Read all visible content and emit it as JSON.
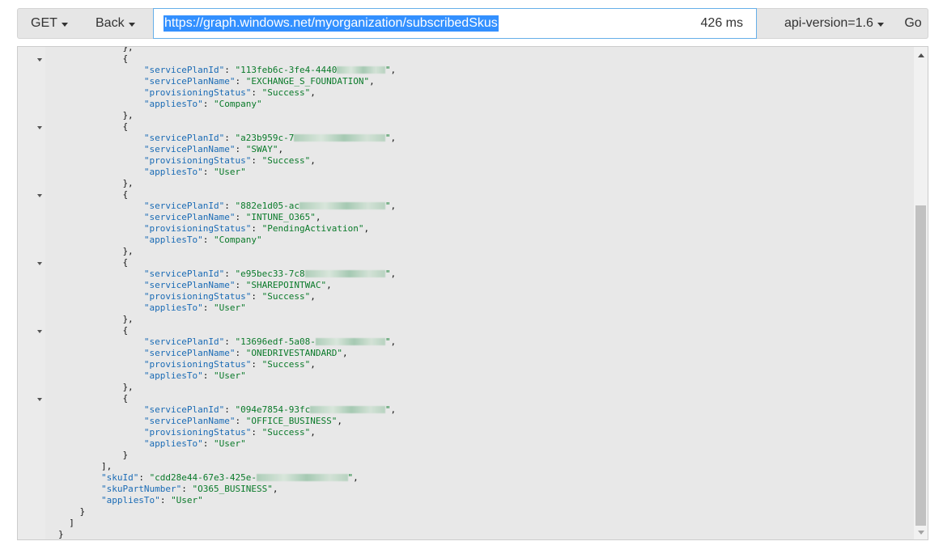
{
  "toolbar": {
    "method": "GET",
    "back": "Back",
    "url": "https://graph.windows.net/myorganization/subscribedSkus",
    "timing": "426 ms",
    "api_version": "api-version=1.6",
    "go": "Go"
  },
  "editor": {
    "lines": [
      {
        "indent": 12,
        "segs": [
          [
            "p",
            "},"
          ]
        ]
      },
      {
        "indent": 12,
        "fold": true,
        "segs": [
          [
            "p",
            "{"
          ]
        ]
      },
      {
        "indent": 16,
        "segs": [
          [
            "k",
            "\"servicePlanId\""
          ],
          [
            "p",
            ": "
          ],
          [
            "s",
            "\"113feb6c-3fe4-4440"
          ],
          [
            "blur",
            "9"
          ],
          [
            "s",
            "\""
          ],
          [
            "p",
            ","
          ]
        ]
      },
      {
        "indent": 16,
        "segs": [
          [
            "k",
            "\"servicePlanName\""
          ],
          [
            "p",
            ": "
          ],
          [
            "s",
            "\"EXCHANGE_S_FOUNDATION\""
          ],
          [
            "p",
            ","
          ]
        ]
      },
      {
        "indent": 16,
        "segs": [
          [
            "k",
            "\"provisioningStatus\""
          ],
          [
            "p",
            ": "
          ],
          [
            "s",
            "\"Success\""
          ],
          [
            "p",
            ","
          ]
        ]
      },
      {
        "indent": 16,
        "segs": [
          [
            "k",
            "\"appliesTo\""
          ],
          [
            "p",
            ": "
          ],
          [
            "s",
            "\"Company\""
          ]
        ]
      },
      {
        "indent": 12,
        "segs": [
          [
            "p",
            "},"
          ]
        ]
      },
      {
        "indent": 12,
        "fold": true,
        "segs": [
          [
            "p",
            "{"
          ]
        ]
      },
      {
        "indent": 16,
        "segs": [
          [
            "k",
            "\"servicePlanId\""
          ],
          [
            "p",
            ": "
          ],
          [
            "s",
            "\"a23b959c-7"
          ],
          [
            "blur",
            "17"
          ],
          [
            "s",
            "\""
          ],
          [
            "p",
            ","
          ]
        ]
      },
      {
        "indent": 16,
        "segs": [
          [
            "k",
            "\"servicePlanName\""
          ],
          [
            "p",
            ": "
          ],
          [
            "s",
            "\"SWAY\""
          ],
          [
            "p",
            ","
          ]
        ]
      },
      {
        "indent": 16,
        "segs": [
          [
            "k",
            "\"provisioningStatus\""
          ],
          [
            "p",
            ": "
          ],
          [
            "s",
            "\"Success\""
          ],
          [
            "p",
            ","
          ]
        ]
      },
      {
        "indent": 16,
        "segs": [
          [
            "k",
            "\"appliesTo\""
          ],
          [
            "p",
            ": "
          ],
          [
            "s",
            "\"User\""
          ]
        ]
      },
      {
        "indent": 12,
        "segs": [
          [
            "p",
            "},"
          ]
        ]
      },
      {
        "indent": 12,
        "fold": true,
        "segs": [
          [
            "p",
            "{"
          ]
        ]
      },
      {
        "indent": 16,
        "segs": [
          [
            "k",
            "\"servicePlanId\""
          ],
          [
            "p",
            ": "
          ],
          [
            "s",
            "\"882e1d05-ac"
          ],
          [
            "blur",
            "16"
          ],
          [
            "s",
            "\""
          ],
          [
            "p",
            ","
          ]
        ]
      },
      {
        "indent": 16,
        "segs": [
          [
            "k",
            "\"servicePlanName\""
          ],
          [
            "p",
            ": "
          ],
          [
            "s",
            "\"INTUNE_O365\""
          ],
          [
            "p",
            ","
          ]
        ]
      },
      {
        "indent": 16,
        "segs": [
          [
            "k",
            "\"provisioningStatus\""
          ],
          [
            "p",
            ": "
          ],
          [
            "s",
            "\"PendingActivation\""
          ],
          [
            "p",
            ","
          ]
        ]
      },
      {
        "indent": 16,
        "segs": [
          [
            "k",
            "\"appliesTo\""
          ],
          [
            "p",
            ": "
          ],
          [
            "s",
            "\"Company\""
          ]
        ]
      },
      {
        "indent": 12,
        "segs": [
          [
            "p",
            "},"
          ]
        ]
      },
      {
        "indent": 12,
        "fold": true,
        "segs": [
          [
            "p",
            "{"
          ]
        ]
      },
      {
        "indent": 16,
        "segs": [
          [
            "k",
            "\"servicePlanId\""
          ],
          [
            "p",
            ": "
          ],
          [
            "s",
            "\"e95bec33-7c8"
          ],
          [
            "blur",
            "15"
          ],
          [
            "s",
            "\""
          ],
          [
            "p",
            ","
          ]
        ]
      },
      {
        "indent": 16,
        "segs": [
          [
            "k",
            "\"servicePlanName\""
          ],
          [
            "p",
            ": "
          ],
          [
            "s",
            "\"SHAREPOINTWAC\""
          ],
          [
            "p",
            ","
          ]
        ]
      },
      {
        "indent": 16,
        "segs": [
          [
            "k",
            "\"provisioningStatus\""
          ],
          [
            "p",
            ": "
          ],
          [
            "s",
            "\"Success\""
          ],
          [
            "p",
            ","
          ]
        ]
      },
      {
        "indent": 16,
        "segs": [
          [
            "k",
            "\"appliesTo\""
          ],
          [
            "p",
            ": "
          ],
          [
            "s",
            "\"User\""
          ]
        ]
      },
      {
        "indent": 12,
        "segs": [
          [
            "p",
            "},"
          ]
        ]
      },
      {
        "indent": 12,
        "fold": true,
        "segs": [
          [
            "p",
            "{"
          ]
        ]
      },
      {
        "indent": 16,
        "segs": [
          [
            "k",
            "\"servicePlanId\""
          ],
          [
            "p",
            ": "
          ],
          [
            "s",
            "\"13696edf-5a08-"
          ],
          [
            "blur",
            "13"
          ],
          [
            "s",
            "\""
          ],
          [
            "p",
            ","
          ]
        ]
      },
      {
        "indent": 16,
        "segs": [
          [
            "k",
            "\"servicePlanName\""
          ],
          [
            "p",
            ": "
          ],
          [
            "s",
            "\"ONEDRIVESTANDARD\""
          ],
          [
            "p",
            ","
          ]
        ]
      },
      {
        "indent": 16,
        "segs": [
          [
            "k",
            "\"provisioningStatus\""
          ],
          [
            "p",
            ": "
          ],
          [
            "s",
            "\"Success\""
          ],
          [
            "p",
            ","
          ]
        ]
      },
      {
        "indent": 16,
        "segs": [
          [
            "k",
            "\"appliesTo\""
          ],
          [
            "p",
            ": "
          ],
          [
            "s",
            "\"User\""
          ]
        ]
      },
      {
        "indent": 12,
        "segs": [
          [
            "p",
            "},"
          ]
        ]
      },
      {
        "indent": 12,
        "fold": true,
        "segs": [
          [
            "p",
            "{"
          ]
        ]
      },
      {
        "indent": 16,
        "segs": [
          [
            "k",
            "\"servicePlanId\""
          ],
          [
            "p",
            ": "
          ],
          [
            "s",
            "\"094e7854-93fc"
          ],
          [
            "blur",
            "14"
          ],
          [
            "s",
            "\""
          ],
          [
            "p",
            ","
          ]
        ]
      },
      {
        "indent": 16,
        "segs": [
          [
            "k",
            "\"servicePlanName\""
          ],
          [
            "p",
            ": "
          ],
          [
            "s",
            "\"OFFICE_BUSINESS\""
          ],
          [
            "p",
            ","
          ]
        ]
      },
      {
        "indent": 16,
        "segs": [
          [
            "k",
            "\"provisioningStatus\""
          ],
          [
            "p",
            ": "
          ],
          [
            "s",
            "\"Success\""
          ],
          [
            "p",
            ","
          ]
        ]
      },
      {
        "indent": 16,
        "segs": [
          [
            "k",
            "\"appliesTo\""
          ],
          [
            "p",
            ": "
          ],
          [
            "s",
            "\"User\""
          ]
        ]
      },
      {
        "indent": 12,
        "segs": [
          [
            "p",
            "}"
          ]
        ]
      },
      {
        "indent": 8,
        "segs": [
          [
            "p",
            "],"
          ]
        ]
      },
      {
        "indent": 8,
        "segs": [
          [
            "k",
            "\"skuId\""
          ],
          [
            "p",
            ": "
          ],
          [
            "s",
            "\"cdd28e44-67e3-425e-"
          ],
          [
            "blur",
            "17"
          ],
          [
            "s",
            "\""
          ],
          [
            "p",
            ","
          ]
        ]
      },
      {
        "indent": 8,
        "segs": [
          [
            "k",
            "\"skuPartNumber\""
          ],
          [
            "p",
            ": "
          ],
          [
            "s",
            "\"O365_BUSINESS\""
          ],
          [
            "p",
            ","
          ]
        ]
      },
      {
        "indent": 8,
        "segs": [
          [
            "k",
            "\"appliesTo\""
          ],
          [
            "p",
            ": "
          ],
          [
            "s",
            "\"User\""
          ]
        ]
      },
      {
        "indent": 4,
        "segs": [
          [
            "p",
            "}"
          ]
        ]
      },
      {
        "indent": 2,
        "segs": [
          [
            "p",
            "]"
          ]
        ]
      },
      {
        "indent": 0,
        "segs": [
          [
            "p",
            "}"
          ]
        ]
      }
    ]
  },
  "icons": {
    "method_dropdown": "chevron-down-icon",
    "back_dropdown": "chevron-down-icon",
    "api_dropdown": "chevron-down-icon",
    "fold": "fold-triangle-icon",
    "scroll_up": "scroll-up-arrow-icon",
    "scroll_down": "scroll-down-arrow-icon"
  }
}
